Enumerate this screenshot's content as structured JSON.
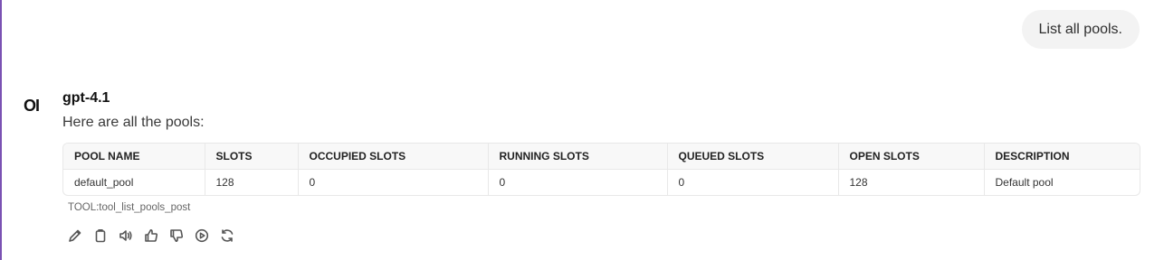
{
  "user_message": "List all pools.",
  "assistant": {
    "avatar_text": "OI",
    "model": "gpt-4.1",
    "intro": "Here are all the pools:",
    "tool_call": "TOOL:tool_list_pools_post"
  },
  "table": {
    "headers": [
      "POOL NAME",
      "SLOTS",
      "OCCUPIED SLOTS",
      "RUNNING SLOTS",
      "QUEUED SLOTS",
      "OPEN SLOTS",
      "DESCRIPTION"
    ],
    "rows": [
      [
        "default_pool",
        "128",
        "0",
        "0",
        "0",
        "128",
        "Default pool"
      ]
    ]
  },
  "actions": [
    "edit-icon",
    "copy-icon",
    "speaker-icon",
    "thumbs-up-icon",
    "thumbs-down-icon",
    "play-icon",
    "regenerate-icon"
  ],
  "colors": {
    "accent_border": "#7a52b3",
    "bubble_bg": "#f3f3f3"
  }
}
